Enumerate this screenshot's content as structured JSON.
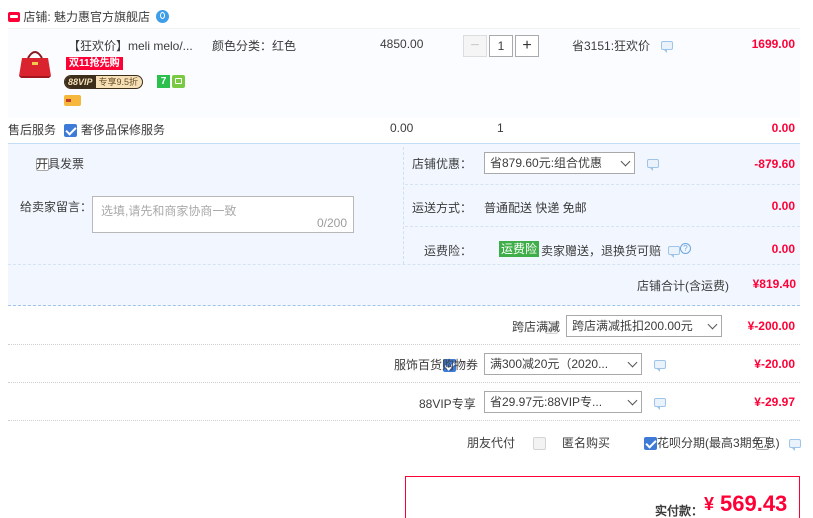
{
  "shop": {
    "prefix": "店铺:",
    "name": "魅力惠官方旗舰店",
    "badge_icon": "tmall-icon"
  },
  "item": {
    "title": "【狂欢价】meli melo/...",
    "sku_label": "颜色分类：红色",
    "original_price": "4850.00",
    "quantity": "1",
    "promo_text": "省3151:狂欢价",
    "price": "1699.00",
    "tag_presale": "双11抢先购",
    "tag_vip_label": "88VIP",
    "tag_vip_discount": "专享9.5折",
    "tag_7": "7"
  },
  "service": {
    "label": "售后服务",
    "option": "奢侈品保修服务",
    "price": "0.00",
    "qty": "1",
    "subtotal": "0.00"
  },
  "invoice": {
    "label": "开具发票"
  },
  "shop_discount": {
    "label": "店铺优惠：",
    "selected": "省879.60元:组合优惠",
    "amount": "-879.60"
  },
  "message": {
    "label": "给卖家留言：",
    "placeholder": "选填,请先和商家协商一致",
    "counter": "0/200"
  },
  "shipping": {
    "label": "运送方式：",
    "value": "普通配送 快递 免邮",
    "amount": "0.00"
  },
  "insurance": {
    "label": "运费险：",
    "tag": "运费险",
    "desc": "卖家赠送，退换货可赔",
    "amount": "0.00"
  },
  "shop_total": {
    "label": "店铺合计(含运费)",
    "amount": "¥819.40"
  },
  "cross_store": {
    "label": "跨店满减",
    "selected": "跨店满减抵扣200.00元",
    "amount": "¥-200.00"
  },
  "coupon": {
    "label": "服饰百货购物券",
    "selected": "满300减20元（2020...",
    "amount": "¥-20.00"
  },
  "vip": {
    "label": "88VIP专享",
    "selected": "省29.97元:88VIP专...",
    "amount": "¥-29.97"
  },
  "options": {
    "friend_pay": "朋友代付",
    "anonymous": "匿名购买",
    "huabei": "花呗分期(最高3期免息)"
  },
  "final": {
    "label": "实付款：",
    "currency": "¥",
    "amount": "569.43"
  },
  "colors": {
    "accent_red": "#ff0036",
    "band_blue": "#f2f7ff",
    "border_blue": "#b2d1ff",
    "checkbox_blue": "#3e7bd6",
    "insurance_green": "#3fae48"
  }
}
